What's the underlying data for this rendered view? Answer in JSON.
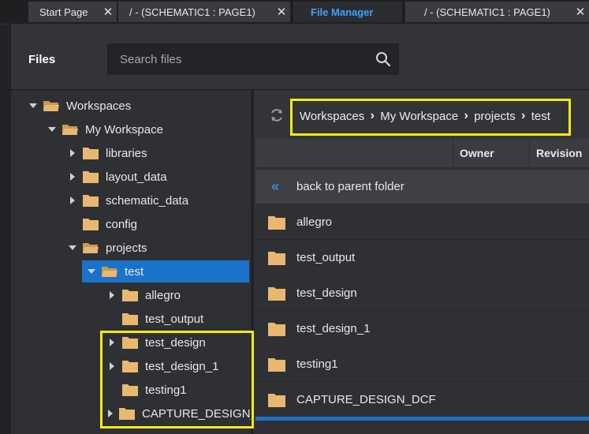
{
  "tabs": [
    {
      "label": "Start Page",
      "active": false
    },
    {
      "label": "/ - (SCHEMATIC1 : PAGE1)",
      "active": false
    },
    {
      "label": "File Manager",
      "active": true
    },
    {
      "label": "/ - (SCHEMATIC1 : PAGE1)",
      "active": false
    }
  ],
  "header": {
    "title": "Files",
    "search_placeholder": "Search files",
    "search_value": ""
  },
  "tree": [
    {
      "label": "Workspaces",
      "expanded": true
    },
    {
      "label": "My Workspace",
      "expanded": true
    },
    {
      "label": "libraries",
      "expanded": false
    },
    {
      "label": "layout_data",
      "expanded": false
    },
    {
      "label": "schematic_data",
      "expanded": false
    },
    {
      "label": "config",
      "expanded": false
    },
    {
      "label": "projects",
      "expanded": true
    },
    {
      "label": "test",
      "expanded": true,
      "selected": true
    },
    {
      "label": "allegro",
      "expanded": false
    },
    {
      "label": "test_output",
      "expanded": false
    },
    {
      "label": "test_design",
      "expanded": false
    },
    {
      "label": "test_design_1",
      "expanded": false
    },
    {
      "label": "testing1",
      "expanded": false
    },
    {
      "label": "CAPTURE_DESIGN_",
      "expanded": false
    }
  ],
  "breadcrumb": [
    "Workspaces",
    "My Workspace",
    "projects",
    "test"
  ],
  "columns": {
    "name": "",
    "owner": "Owner",
    "revision": "Revision"
  },
  "back_label": "back to parent folder",
  "files": [
    "allegro",
    "test_output",
    "test_design",
    "test_design_1",
    "testing1",
    "CAPTURE_DESIGN_DCF"
  ],
  "colors": {
    "accent": "#3aa0ff",
    "selection": "#1a73c9",
    "highlight": "#f5ea14",
    "folder": "#e8b871"
  },
  "icons": {
    "refresh": "refresh-icon",
    "search": "search-icon",
    "folder": "folder-icon",
    "back": "double-chevron-left-icon",
    "close": "close-icon"
  }
}
